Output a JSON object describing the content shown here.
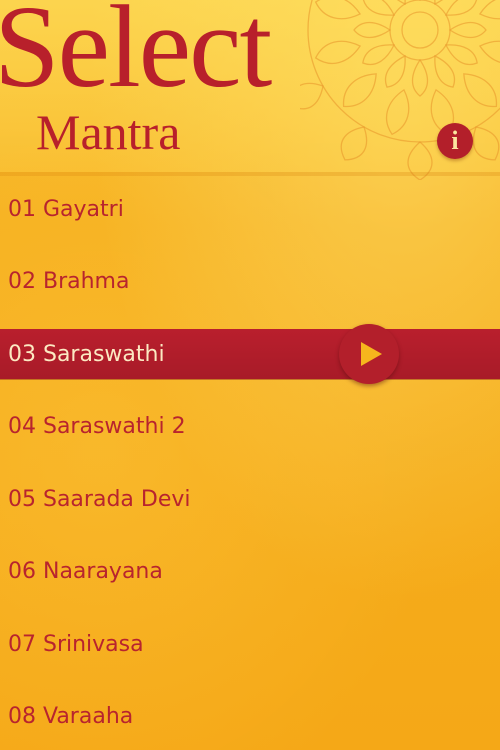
{
  "header": {
    "title": "Select",
    "subtitle": "Mantra",
    "info_label": "i"
  },
  "mantras": {
    "items": [
      {
        "label": "01 Gayatri"
      },
      {
        "label": "02 Brahma"
      },
      {
        "label": "03 Saraswathi",
        "selected": true
      },
      {
        "label": "04 Saraswathi 2"
      },
      {
        "label": "05 Saarada Devi"
      },
      {
        "label": "06 Naarayana"
      },
      {
        "label": "07 Srinivasa"
      },
      {
        "label": "08 Varaaha"
      }
    ]
  },
  "icons": {
    "info": "info-icon",
    "play": "play-icon",
    "decoration": "mandala-flower"
  },
  "colors": {
    "accent_red": "#b8202b",
    "background_yellow": "#f6b01f",
    "selected_text": "#fce9c2",
    "play_triangle": "#f6b61d"
  }
}
